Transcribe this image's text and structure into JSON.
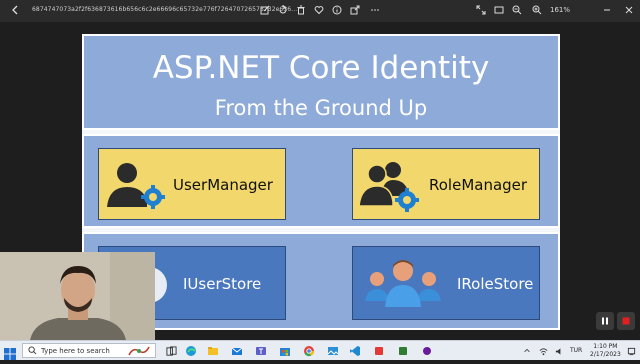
{
  "viewer": {
    "filename": "6874747073a2f2f636873616b656c6c2e66696c65732e776f726470726573732e636...",
    "zoom": "161%"
  },
  "slide": {
    "title": "ASP.NET Core Identity",
    "subtitle": "From the Ground Up",
    "boxes": [
      {
        "label": "UserManager",
        "icon": "user-gear-icon"
      },
      {
        "label": "RoleManager",
        "icon": "users-gear-icon"
      },
      {
        "label": "IUserStore",
        "icon": "user-circle-icon"
      },
      {
        "label": "IRoleStore",
        "icon": "people-group-icon"
      }
    ]
  },
  "taskbar": {
    "search_placeholder": "Type here to search",
    "language": "TUR",
    "time": "1:10 PM",
    "date": "2/17/2023"
  },
  "colors": {
    "panel": "#8eaad8",
    "yellow_box": "#f2d86c",
    "blue_box": "#4a78bf",
    "stop": "#e02020"
  }
}
